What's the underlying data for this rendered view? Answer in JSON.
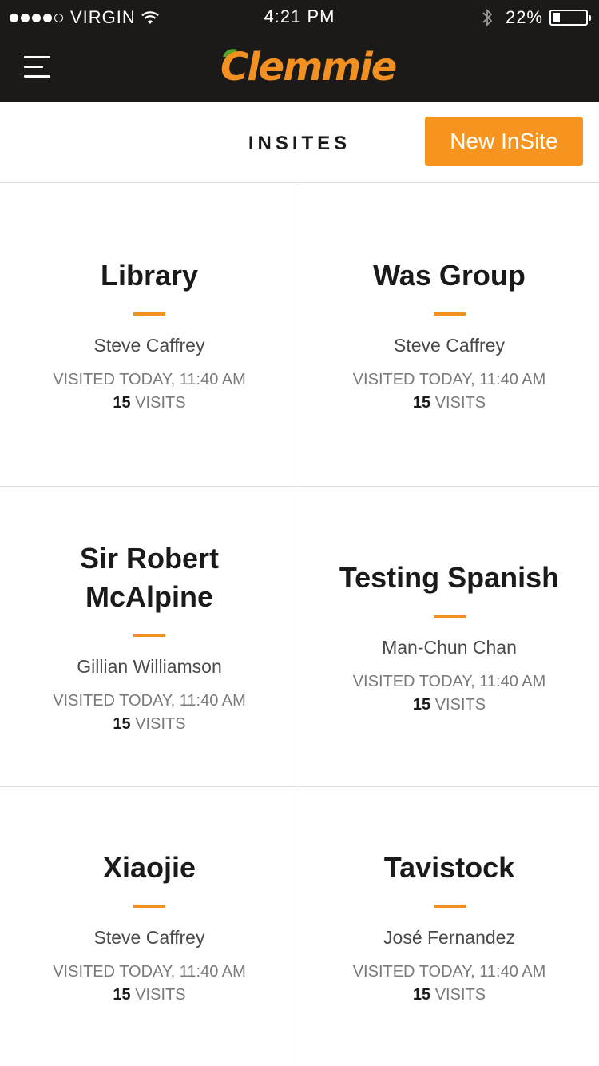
{
  "status_bar": {
    "carrier": "VIRGIN",
    "time": "4:21 PM",
    "battery": "22%",
    "battery_level": 0.22
  },
  "nav": {
    "logo_text": "Clemmie",
    "brand_color": "#f29022"
  },
  "header": {
    "title": "INSITES",
    "new_button_label": "New InSite"
  },
  "cards": [
    {
      "title": "Library",
      "owner": "Steve Caffrey",
      "visited": "VISITED TODAY, 11:40 AM",
      "visits_count": "15",
      "visits_label": "VISITS"
    },
    {
      "title": "Was Group",
      "owner": "Steve Caffrey",
      "visited": "VISITED TODAY, 11:40 AM",
      "visits_count": "15",
      "visits_label": "VISITS"
    },
    {
      "title": "Sir Robert McAlpine",
      "owner": "Gillian Williamson",
      "visited": "VISITED TODAY, 11:40 AM",
      "visits_count": "15",
      "visits_label": "VISITS"
    },
    {
      "title": "Testing Spanish",
      "owner": "Man-Chun Chan",
      "visited": "VISITED TODAY, 11:40 AM",
      "visits_count": "15",
      "visits_label": "VISITS"
    },
    {
      "title": "Xiaojie",
      "owner": "Steve Caffrey",
      "visited": "VISITED TODAY, 11:40 AM",
      "visits_count": "15",
      "visits_label": "VISITS"
    },
    {
      "title": "Tavistock",
      "owner": "José Fernandez",
      "visited": "VISITED TODAY, 11:40 AM",
      "visits_count": "15",
      "visits_label": "VISITS"
    }
  ]
}
